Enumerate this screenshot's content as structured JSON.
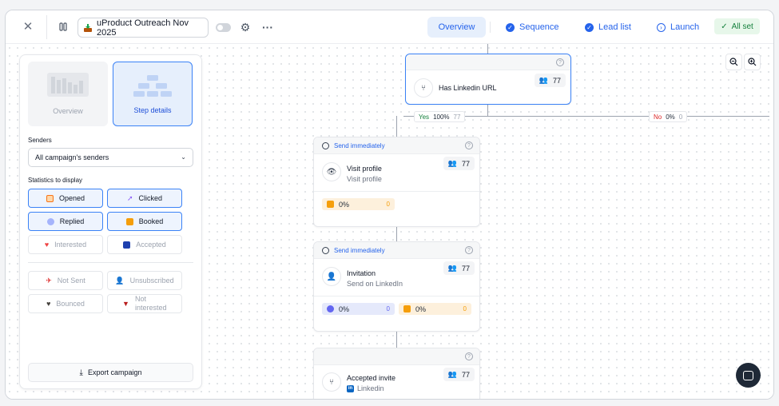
{
  "campaign": {
    "name": "uProduct Outreach Nov 2025"
  },
  "nav": {
    "tabs": [
      {
        "label": "Overview",
        "state": "active"
      },
      {
        "label": "Sequence",
        "state": "done"
      },
      {
        "label": "Lead list",
        "state": "done"
      },
      {
        "label": "Launch",
        "state": "pending"
      }
    ],
    "status_label": "All set"
  },
  "panel": {
    "modes": [
      {
        "label": "Overview"
      },
      {
        "label": "Step details"
      }
    ],
    "senders_label": "Senders",
    "senders_value": "All campaign's senders",
    "stats_label": "Statistics to display",
    "stats": [
      {
        "label": "Opened",
        "on": true,
        "color": "#f97316"
      },
      {
        "label": "Clicked",
        "on": true,
        "color": "#8b5cf6"
      },
      {
        "label": "Replied",
        "on": true,
        "color": "#6366f1"
      },
      {
        "label": "Booked",
        "on": true,
        "color": "#f59e0b"
      },
      {
        "label": "Interested",
        "on": false,
        "color": "#ef4444"
      },
      {
        "label": "Accepted",
        "on": false,
        "color": "#1e40af"
      },
      {
        "label": "Not Sent",
        "on": false,
        "color": "#dc2626"
      },
      {
        "label": "Unsubscribed",
        "on": false,
        "color": "#57534e"
      },
      {
        "label": "Bounced",
        "on": false,
        "color": "#44403c"
      },
      {
        "label": "Not interested",
        "on": false,
        "color": "#b91c1c"
      }
    ],
    "export_label": "Export campaign"
  },
  "flow": {
    "condition": {
      "title": "Has Linkedin URL",
      "count": "77"
    },
    "yes_branch": {
      "label": "Yes",
      "percent": "100%",
      "count": "77"
    },
    "no_branch": {
      "label": "No",
      "percent": "0%",
      "count": "0"
    },
    "steps": [
      {
        "timing": "Send immediately",
        "title": "Visit profile",
        "subtitle": "Visit profile",
        "count": "77",
        "stats": [
          {
            "percent": "0%",
            "value": "0",
            "color": "#f59e0b"
          }
        ]
      },
      {
        "timing": "Send immediately",
        "title": "Invitation",
        "subtitle": "Send on LinkedIn",
        "count": "77",
        "stats": [
          {
            "percent": "0%",
            "value": "0",
            "color": "#6366f1"
          },
          {
            "percent": "0%",
            "value": "0",
            "color": "#f59e0b"
          }
        ]
      },
      {
        "timing": "",
        "title": "Accepted invite",
        "subtitle": "Linkedin",
        "count": "77"
      }
    ]
  },
  "colors": {
    "accent": "#2563eb",
    "accent_bg": "#e6effc",
    "success": "#15803d",
    "danger": "#dc2626"
  }
}
